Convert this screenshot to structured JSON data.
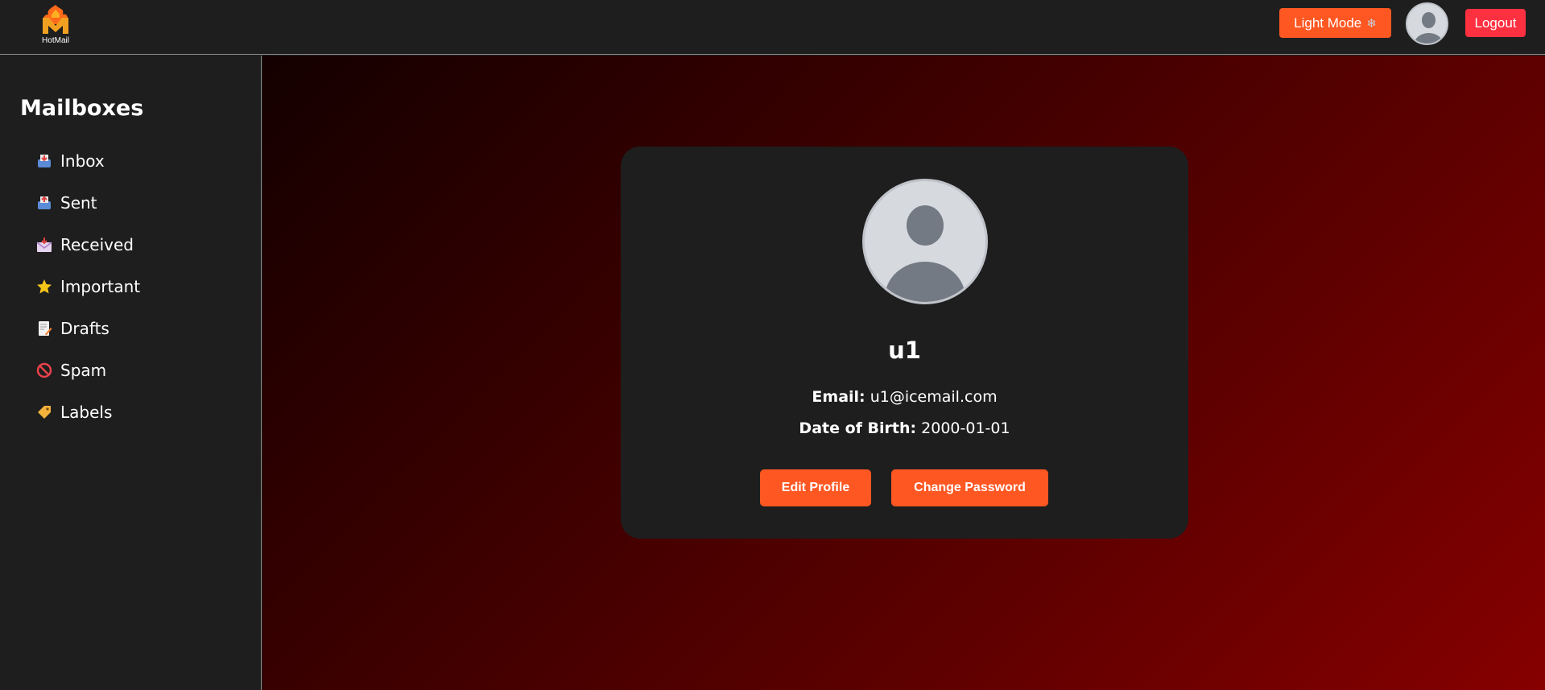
{
  "header": {
    "logo_text": "HotMail",
    "theme_button_label": "Light Mode",
    "theme_button_icon": "snowflake-icon",
    "logout_label": "Logout"
  },
  "sidebar": {
    "title": "Mailboxes",
    "items": [
      {
        "label": "Inbox",
        "icon": "inbox-tray-icon"
      },
      {
        "label": "Sent",
        "icon": "outbox-tray-icon"
      },
      {
        "label": "Received",
        "icon": "incoming-envelope-icon"
      },
      {
        "label": "Important",
        "icon": "star-icon"
      },
      {
        "label": "Drafts",
        "icon": "memo-icon"
      },
      {
        "label": "Spam",
        "icon": "prohibited-icon"
      },
      {
        "label": "Labels",
        "icon": "label-tag-icon"
      }
    ]
  },
  "profile": {
    "username": "u1",
    "email_label": "Email:",
    "email_value": "u1@icemail.com",
    "dob_label": "Date of Birth:",
    "dob_value": "2000-01-01",
    "edit_button": "Edit Profile",
    "change_password_button": "Change Password"
  },
  "colors": {
    "accent": "#ff5722",
    "logout": "#ff3040",
    "panel": "#1e1e1e",
    "background_gradient": [
      "#140000",
      "#860000"
    ]
  }
}
